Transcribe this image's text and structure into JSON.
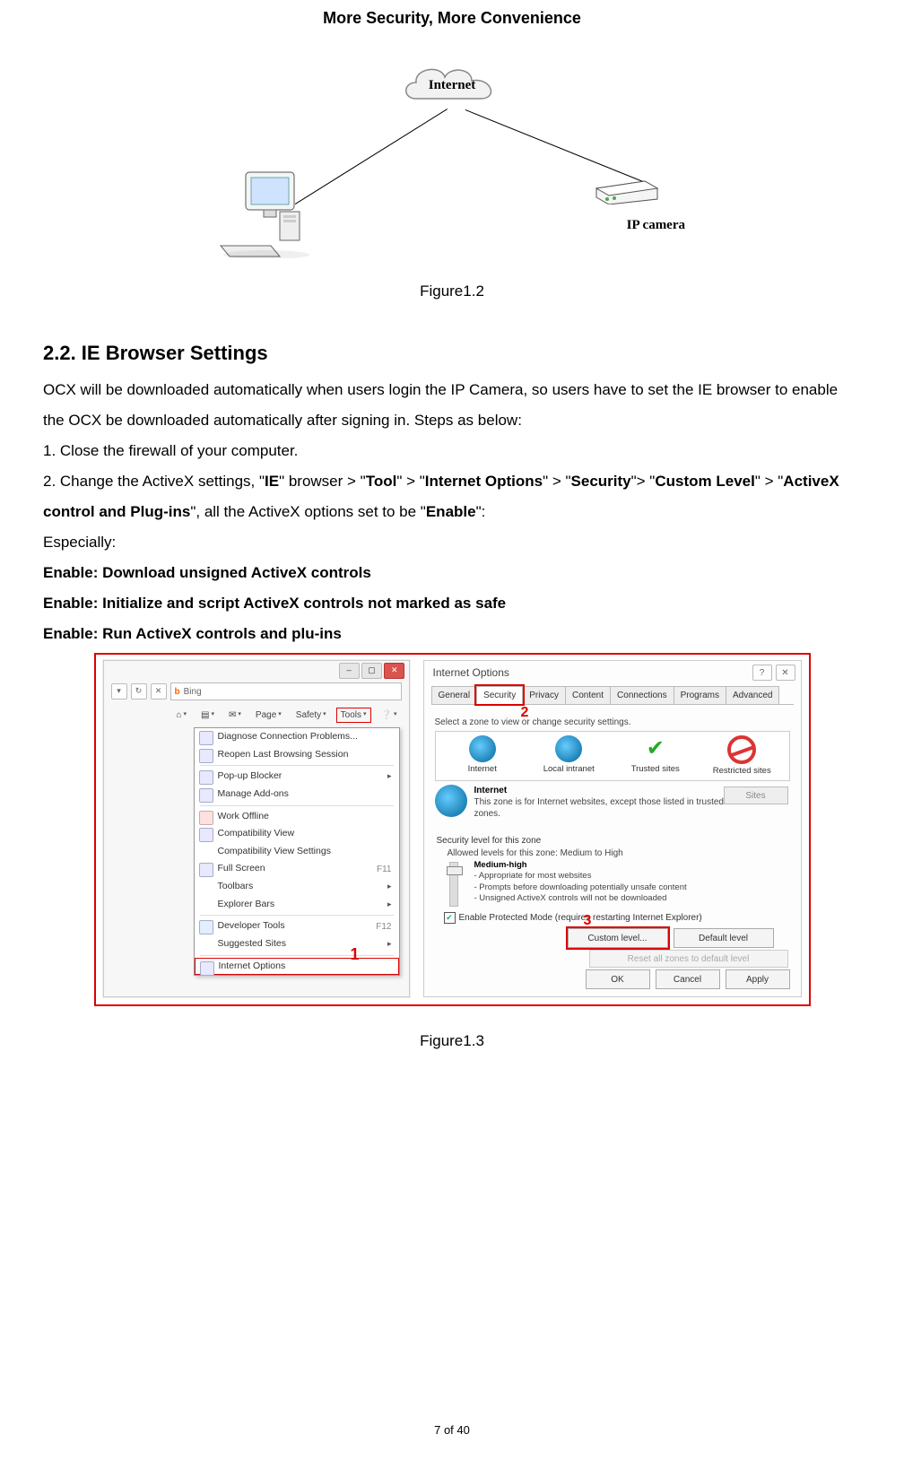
{
  "header": {
    "title": "More Security, More Convenience"
  },
  "figure12": {
    "internet_label": "Internet",
    "ipcamera_label": "IP camera",
    "caption": "Figure1.2"
  },
  "section": {
    "heading": "2.2. IE Browser Settings",
    "p1": "OCX will be downloaded automatically when users login the IP Camera, so users have to set the IE browser to enable the OCX be downloaded automatically after signing in. Steps as below:",
    "step1": "1. Close the firewall of your computer.",
    "step2_pre": "2. Change the ActiveX settings, \"",
    "step2_ie": "IE",
    "step2_b1": "\" browser > \"",
    "step2_tool": "Tool",
    "step2_b2": "\" > \"",
    "step2_io": "Internet Options",
    "step2_b3": "\" > \"",
    "step2_sec": "Security",
    "step2_b4": "\"> \"",
    "step2_cl": "Custom Level",
    "step2_b5": "\" > \"",
    "step2_ax": "ActiveX control and Plug-ins",
    "step2_b6": "\", all the ActiveX options set to be \"",
    "step2_en": "Enable",
    "step2_b7": "\":",
    "esp": "Especially:",
    "e1": "Enable: Download unsigned ActiveX controls",
    "e2": "Enable: Initialize and script ActiveX controls not marked as safe",
    "e3": "Enable: Run ActiveX controls and plu-ins"
  },
  "figure13": {
    "caption": "Figure1.3",
    "annot1": "1",
    "annot2": "2",
    "annot3": "3",
    "left": {
      "bing": "Bing",
      "tb_home": "",
      "tb_print": "",
      "tb_page": "Page",
      "tb_safety": "Safety",
      "tb_tools": "Tools",
      "menu": {
        "diag": "Diagnose Connection Problems...",
        "reopen": "Reopen Last Browsing Session",
        "popup": "Pop-up Blocker",
        "addons": "Manage Add-ons",
        "offline": "Work Offline",
        "compat": "Compatibility View",
        "compatset": "Compatibility View Settings",
        "full": "Full Screen",
        "full_k": "F11",
        "toolbars": "Toolbars",
        "expbars": "Explorer Bars",
        "devtools": "Developer Tools",
        "devtools_k": "F12",
        "sugg": "Suggested Sites",
        "iopts": "Internet Options"
      }
    },
    "right": {
      "title": "Internet Options",
      "tabs": {
        "general": "General",
        "security": "Security",
        "privacy": "Privacy",
        "content": "Content",
        "connections": "Connections",
        "programs": "Programs",
        "advanced": "Advanced"
      },
      "zone_hint": "Select a zone to view or change security settings.",
      "zones": {
        "internet": "Internet",
        "local": "Local intranet",
        "trusted": "Trusted sites",
        "restricted": "Restricted sites"
      },
      "zone_desc_title": "Internet",
      "zone_desc": "This zone is for Internet websites, except those listed in trusted and restricted zones.",
      "sites": "Sites",
      "sec_label": "Security level for this zone",
      "sec_range": "Allowed levels for this zone: Medium to High",
      "mh_title": "Medium-high",
      "mh_l1": "- Appropriate for most websites",
      "mh_l2": "- Prompts before downloading potentially unsafe content",
      "mh_l3": "- Unsigned ActiveX controls will not be downloaded",
      "protected": "Enable Protected Mode (requires restarting Internet Explorer)",
      "custom": "Custom level...",
      "default": "Default level",
      "reset": "Reset all zones to default level",
      "ok": "OK",
      "cancel": "Cancel",
      "apply": "Apply"
    }
  },
  "footer": {
    "page": "7 of 40"
  }
}
